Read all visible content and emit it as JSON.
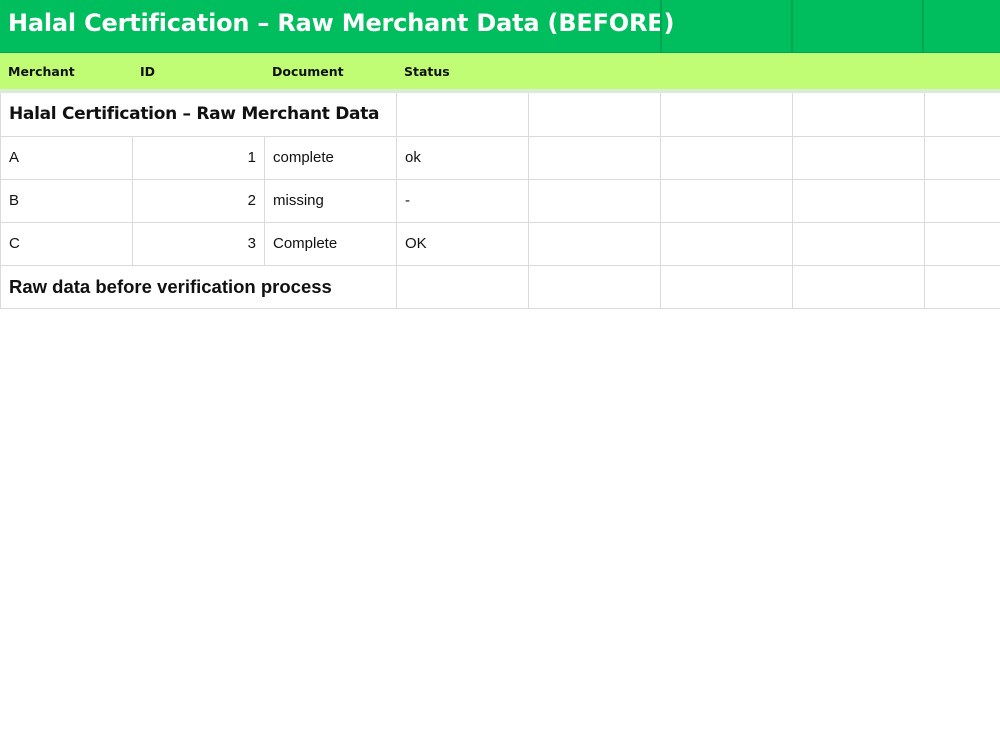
{
  "sheet": {
    "title": "Halal Certification – Raw Merchant Data (BEFORE)",
    "headers": [
      "Merchant",
      "ID",
      "Document",
      "Status"
    ],
    "section_title": "Halal Certification – Raw Merchant Data",
    "rows": [
      {
        "merchant": "A",
        "id": "1",
        "document": "complete",
        "status": "ok"
      },
      {
        "merchant": "B",
        "id": "2",
        "document": "missing",
        "status": "-"
      },
      {
        "merchant": "C",
        "id": "3",
        "document": "Complete",
        "status": "OK"
      }
    ],
    "footer_note": "Raw data before verification process"
  },
  "colors": {
    "title_bar": "#00bd5e",
    "header_bar": "#c0fd75",
    "title_text": "#ffffff",
    "grid_line": "#dadada"
  }
}
